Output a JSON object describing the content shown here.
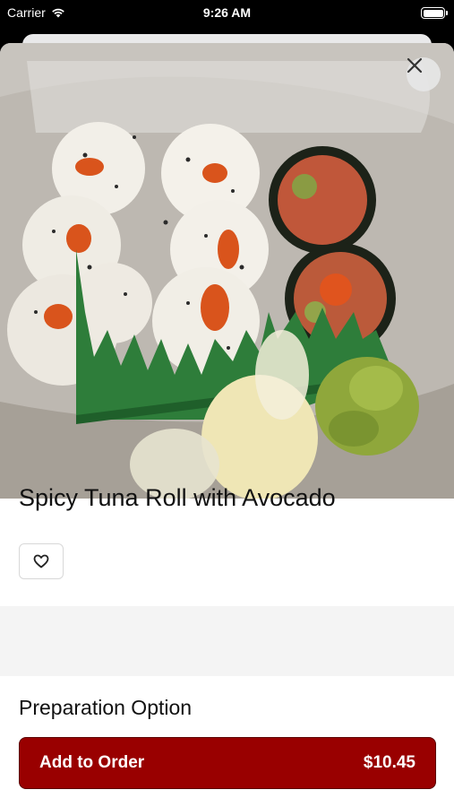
{
  "status_bar": {
    "carrier": "Carrier",
    "time": "9:26 AM"
  },
  "item": {
    "title": "Spicy Tuna Roll with Avocado"
  },
  "sections": {
    "preparation_title": "Preparation Option"
  },
  "order_button": {
    "label": "Add to Order",
    "price": "$10.45"
  },
  "colors": {
    "accent": "#990000"
  },
  "icons": {
    "close": "close-icon",
    "favorite": "heart-icon",
    "wifi": "wifi-icon",
    "battery": "battery-icon"
  }
}
